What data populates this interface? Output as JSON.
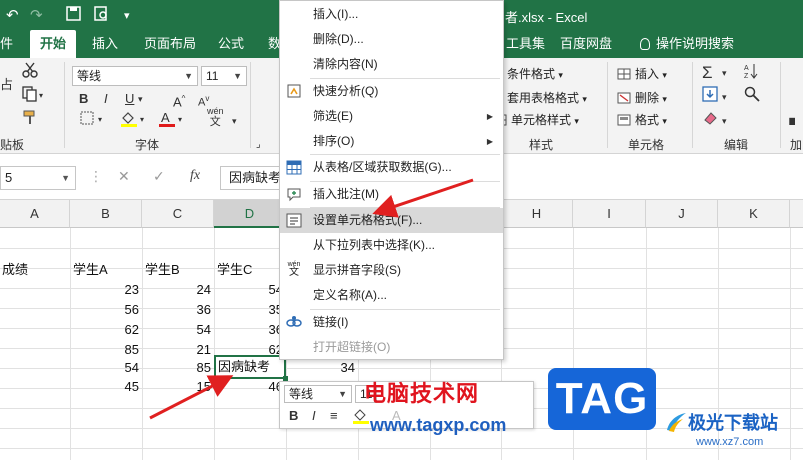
{
  "titlebar": {
    "title": "者.xlsx - Excel",
    "bg_color": "#217346"
  },
  "ribbon_tabs": {
    "file": "件",
    "home": "开始",
    "insert": "插入",
    "layout": "页面布局",
    "formula": "公式",
    "data": "数",
    "tools": "工具集",
    "baidu": "百度网盘",
    "tellme": "操作说明搜索"
  },
  "ribbon": {
    "clipboard_label": "贴板",
    "paste_label": "占",
    "font_name": "等线",
    "font_size": "11",
    "font_group_label": "字体",
    "wen_label": "wén",
    "wen_char": "文",
    "conditional_format": "条件格式",
    "table_format": "套用表格格式",
    "cell_style": "单元格样式",
    "styles_group_label": "样式",
    "insert_btn": "插入",
    "delete_btn": "删除",
    "format_btn": "格式",
    "cells_group_label": "单元格",
    "editing_group_label": "编辑",
    "more_label": "加"
  },
  "formula_bar": {
    "name_box": "5",
    "content": "因病缺考"
  },
  "columns": [
    "A",
    "B",
    "C",
    "D",
    "",
    "H",
    "I",
    "J",
    "K"
  ],
  "headers_row": [
    "成绩",
    "学生A",
    "学生B",
    "学生C"
  ],
  "rows": [
    {
      "b": "23",
      "c": "24",
      "d": "54"
    },
    {
      "b": "56",
      "c": "36",
      "d": "35"
    },
    {
      "b": "62",
      "c": "54",
      "d": "36"
    },
    {
      "b": "85",
      "c": "21",
      "d": "62"
    },
    {
      "b": "54",
      "c": "85",
      "d": "因病缺考",
      "e": "34"
    },
    {
      "b": "45",
      "c": "15",
      "d": "46"
    }
  ],
  "context_menu": {
    "items": [
      {
        "label": "插入(I)...",
        "icon": "none"
      },
      {
        "label": "删除(D)...",
        "icon": "none"
      },
      {
        "label": "清除内容(N)",
        "icon": "none"
      },
      {
        "label": "快速分析(Q)",
        "icon": "quick-analysis-icon"
      },
      {
        "label": "筛选(E)",
        "icon": "none",
        "submenu": true
      },
      {
        "label": "排序(O)",
        "icon": "none",
        "submenu": true
      },
      {
        "label": "从表格/区域获取数据(G)...",
        "icon": "table-icon"
      },
      {
        "label": "插入批注(M)",
        "icon": "comment-icon"
      },
      {
        "label": "设置单元格格式(F)...",
        "icon": "format-cells-icon",
        "highlighted": true
      },
      {
        "label": "从下拉列表中选择(K)...",
        "icon": "none"
      },
      {
        "label": "显示拼音字段(S)",
        "icon": "phonetic-icon"
      },
      {
        "label": "定义名称(A)...",
        "icon": "none"
      },
      {
        "label": "链接(I)",
        "icon": "link-icon"
      },
      {
        "label": "打开超链接(O)",
        "icon": "none",
        "disabled": true
      }
    ]
  },
  "mini_toolbar": {
    "font_name": "等线",
    "font_size": "11"
  },
  "watermark": {
    "site_name": "电脑技术网",
    "url": "www.tagxp.com",
    "tag": "TAG",
    "brand": "极光下载站",
    "brand_url": "www.xz7.com"
  },
  "colors": {
    "accent": "#217346",
    "arrow": "#e02020",
    "tag_blue": "#1666d8"
  }
}
